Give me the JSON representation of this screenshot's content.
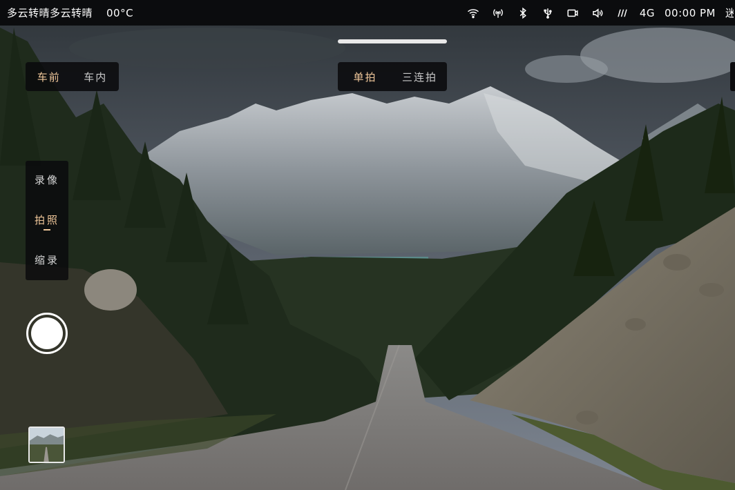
{
  "status_bar": {
    "weather": "多云转晴多云转晴",
    "temperature": "00°C",
    "network": "4G",
    "time": "00:00 PM",
    "cut_text": "迷",
    "icons": [
      "wifi-icon",
      "hotspot-icon",
      "bluetooth-icon",
      "usb-icon",
      "dashcam-icon",
      "volume-icon",
      "signal-icon"
    ]
  },
  "camera_switch": {
    "front": "车前",
    "inside": "车内",
    "selected": "车前"
  },
  "shot_mode": {
    "single": "单拍",
    "triple": "三连拍",
    "selected": "单拍"
  },
  "capture_modes": {
    "video": "录像",
    "photo": "拍照",
    "timelapse": "缩录",
    "selected": "拍照"
  },
  "colors": {
    "accent": "#f0c79a",
    "status_bar_bg": "#0b0c0e",
    "control_bg": "#0a0a0c"
  }
}
